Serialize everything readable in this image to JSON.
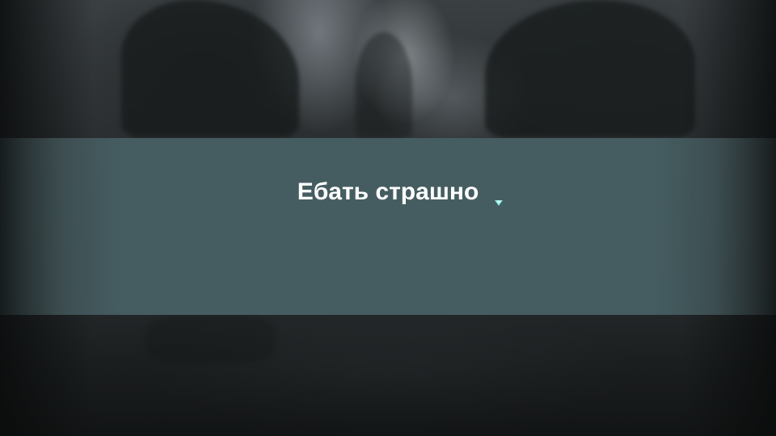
{
  "dialogue": {
    "text": "Ебать страшно",
    "advance_icon": "continue-arrow-icon"
  },
  "colors": {
    "band": "#455d61",
    "text": "#ffffff",
    "advance_icon": "#7fe3dc"
  }
}
